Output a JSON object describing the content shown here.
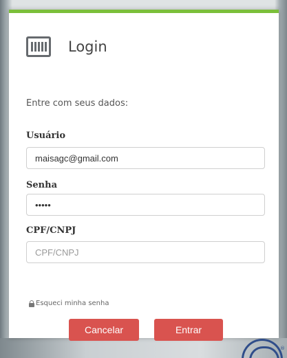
{
  "dialog": {
    "title": "Login",
    "instructions": "Entre com seus dados:",
    "accent_color": "#7bbf3a",
    "fields": {
      "username": {
        "label": "Usuário",
        "value": "maisagc@gmail.com",
        "placeholder": ""
      },
      "password": {
        "label": "Senha",
        "value": "•••••",
        "placeholder": ""
      },
      "document": {
        "label": "CPF/CNPJ",
        "value": "",
        "placeholder": "CPF/CNPJ"
      }
    },
    "forgot_password_link": "Esqueci minha senha",
    "buttons": {
      "cancel": "Cancelar",
      "submit": "Entrar",
      "color": "#d9534f"
    },
    "icons": {
      "header": "barcode-icon",
      "forgot": "lock-icon",
      "corner": "brand-logo"
    },
    "corner_mark": "®"
  }
}
